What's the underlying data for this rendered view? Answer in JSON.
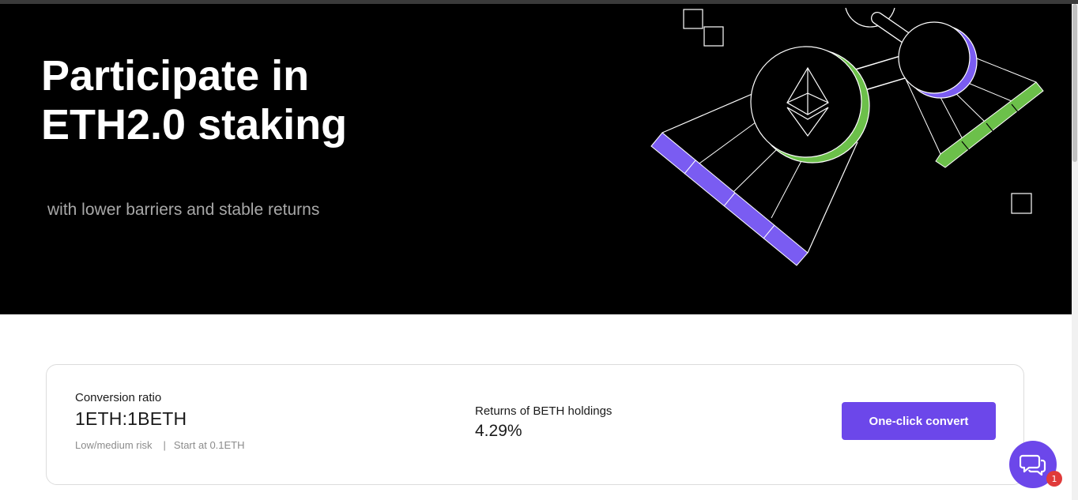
{
  "hero": {
    "title_line1": "Participate in",
    "title_line2": "ETH2.0 staking",
    "subtitle": "with lower barriers and stable returns",
    "illustration": "eth-staking-illustration"
  },
  "card": {
    "conversion_label": "Conversion ratio",
    "conversion_value": "1ETH:1BETH",
    "risk_text": "Low/medium risk",
    "separator": "|",
    "start_text": "Start at 0.1ETH",
    "returns_label": "Returns of BETH holdings",
    "returns_value": "4.29%",
    "convert_button": "One-click convert"
  },
  "chat": {
    "icon": "chat-icon",
    "badge_count": "1"
  },
  "colors": {
    "accent": "#6c47ea",
    "green": "#6cc04a",
    "hero_bg": "#000000",
    "badge": "#e03a3a"
  }
}
